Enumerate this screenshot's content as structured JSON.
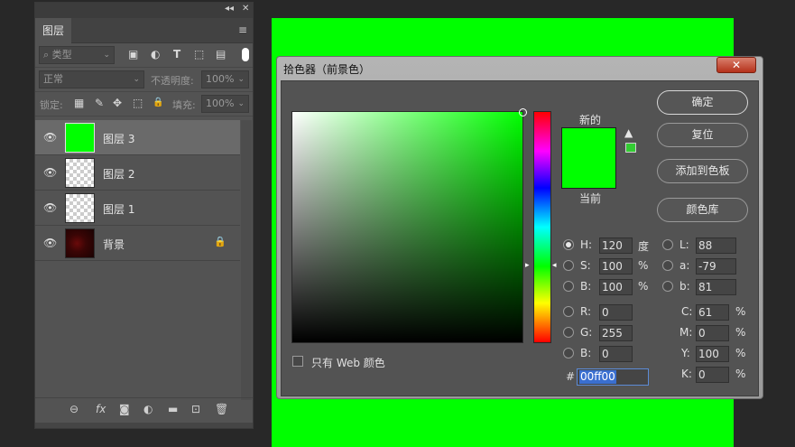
{
  "canvas": {
    "color": "#00ff00"
  },
  "layers_panel": {
    "topbar": {
      "collapse": "◂◂",
      "close": "✕"
    },
    "tab": "图层",
    "menu": "≡",
    "filter": {
      "search_icon": "⌕",
      "kind": "类型",
      "icons": [
        "▣",
        "◐",
        "T",
        "⬚",
        "▤"
      ]
    },
    "blend_mode": "正常",
    "opacity_label": "不透明度:",
    "opacity_value": "100%",
    "lock_label": "锁定:",
    "lock_icons": [
      "▦",
      "✎",
      "✥",
      "⬚",
      "🔒"
    ],
    "fill_label": "填充:",
    "fill_value": "100%",
    "layers": [
      {
        "name": "图层 3",
        "selected": true,
        "thumb": "green",
        "eye": "👁"
      },
      {
        "name": "图层 2",
        "selected": false,
        "thumb": "transparent",
        "eye": "👁"
      },
      {
        "name": "图层 1",
        "selected": false,
        "thumb": "transparent",
        "eye": "👁"
      },
      {
        "name": "背景",
        "selected": false,
        "thumb": "background",
        "eye": "👁",
        "lock": "🔒"
      }
    ],
    "bottom_icons": [
      "⊖",
      "fx",
      "◙",
      "◐",
      "▬",
      "⊡",
      "🗑"
    ]
  },
  "dialog": {
    "title": "拾色器（前景色）",
    "close": "✕",
    "new_label": "新的",
    "current_label": "当前",
    "new_color": "#00ff00",
    "current_color": "#00ff00",
    "gamut_warning": "▲",
    "websafe_color": "#33cc33",
    "hue_arrow_left": "▸",
    "hue_arrow_right": "◂",
    "buttons": {
      "ok": "确定",
      "reset": "复位",
      "add_swatch": "添加到色板",
      "libraries": "颜色库"
    },
    "hsb": {
      "h_label": "H:",
      "h_value": "120",
      "h_unit": "度",
      "s_label": "S:",
      "s_value": "100",
      "s_unit": "%",
      "b_label": "B:",
      "b_value": "100",
      "b_unit": "%"
    },
    "rgb": {
      "r_label": "R:",
      "r_value": "0",
      "g_label": "G:",
      "g_value": "255",
      "b_label": "B:",
      "b_value": "0"
    },
    "lab": {
      "l_label": "L:",
      "l_value": "88",
      "a_label": "a:",
      "a_value": "-79",
      "b_label": "b:",
      "b_value": "81"
    },
    "cmyk": {
      "c_label": "C:",
      "c_value": "61",
      "m_label": "M:",
      "m_value": "0",
      "y_label": "Y:",
      "y_value": "100",
      "k_label": "K:",
      "k_value": "0",
      "unit": "%"
    },
    "hex_hash": "#",
    "hex_value": "00ff00",
    "web_only_label": "只有 Web 颜色"
  }
}
